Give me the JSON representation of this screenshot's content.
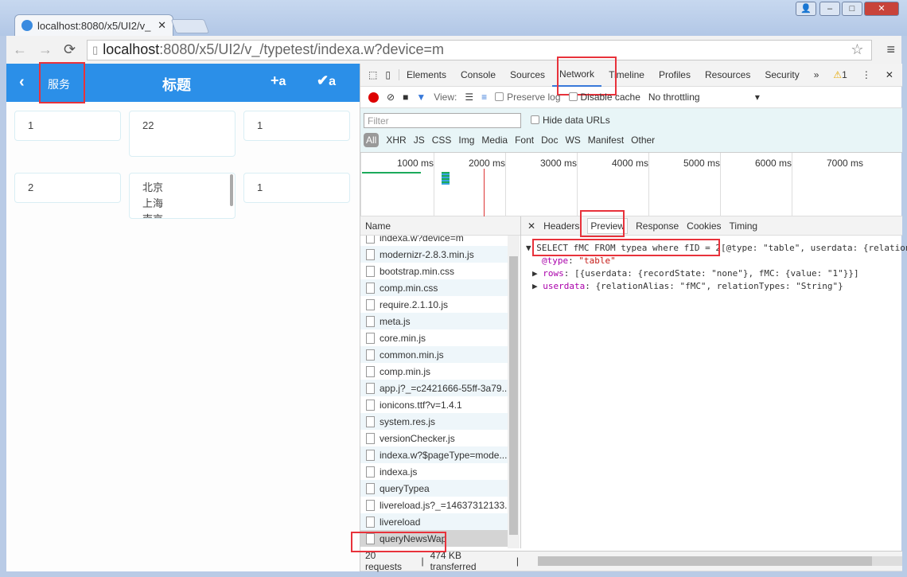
{
  "browser": {
    "tab_title": "localhost:8080/x5/UI2/v_",
    "url_host": "localhost",
    "url_rest": ":8080/x5/UI2/v_/typetest/indexa.w?device=m"
  },
  "app": {
    "back_label": "服务",
    "title": "标题",
    "add_label": "a",
    "check_label": "a",
    "rows": [
      [
        "1",
        "22",
        "1"
      ],
      [
        "2",
        [
          "北京",
          "上海",
          "南京"
        ],
        "1"
      ]
    ]
  },
  "devtools": {
    "tabs": [
      "Elements",
      "Console",
      "Sources",
      "Network",
      "Timeline",
      "Profiles",
      "Resources",
      "Security"
    ],
    "active_tab": "Network",
    "warning_count": "1",
    "toolbar": {
      "view_label": "View:",
      "preserve_log": "Preserve log",
      "disable_cache": "Disable cache",
      "throttling": "No throttling"
    },
    "filter_placeholder": "Filter",
    "hide_data_urls": "Hide data URLs",
    "types": [
      "All",
      "XHR",
      "JS",
      "CSS",
      "Img",
      "Media",
      "Font",
      "Doc",
      "WS",
      "Manifest",
      "Other"
    ],
    "timeline_ticks": [
      "1000 ms",
      "2000 ms",
      "3000 ms",
      "4000 ms",
      "5000 ms",
      "6000 ms",
      "7000 ms"
    ],
    "name_header": "Name",
    "files": [
      "indexa.w?device=m",
      "modernizr-2.8.3.min.js",
      "bootstrap.min.css",
      "comp.min.css",
      "require.2.1.10.js",
      "meta.js",
      "core.min.js",
      "common.min.js",
      "comp.min.js",
      "app.j?_=c2421666-55ff-3a79...",
      "ionicons.ttf?v=1.4.1",
      "system.res.js",
      "versionChecker.js",
      "indexa.w?$pageType=mode...",
      "indexa.js",
      "queryTypea",
      "livereload.js?_=14637312133...",
      "livereload",
      "queryNewsWap"
    ],
    "selected_file": "queryNewsWap",
    "detail_tabs": [
      "Headers",
      "Preview",
      "Response",
      "Cookies",
      "Timing"
    ],
    "active_detail_tab": "Preview",
    "preview": {
      "sql": "SELECT fMC FROM typea where fID = 2",
      "summary": "[@type: \"table\", userdata: {relationAlias",
      "type_key": "@type",
      "type_val": "\"table\"",
      "rows_key": "rows",
      "rows_val": "[{userdata: {recordState: \"none\"}, fMC: {value: \"1\"}}]",
      "userdata_key": "userdata",
      "userdata_val": "{relationAlias: \"fMC\", relationTypes: \"String\"}"
    },
    "status": {
      "requests": "20 requests",
      "transferred": "474 KB transferred"
    }
  }
}
